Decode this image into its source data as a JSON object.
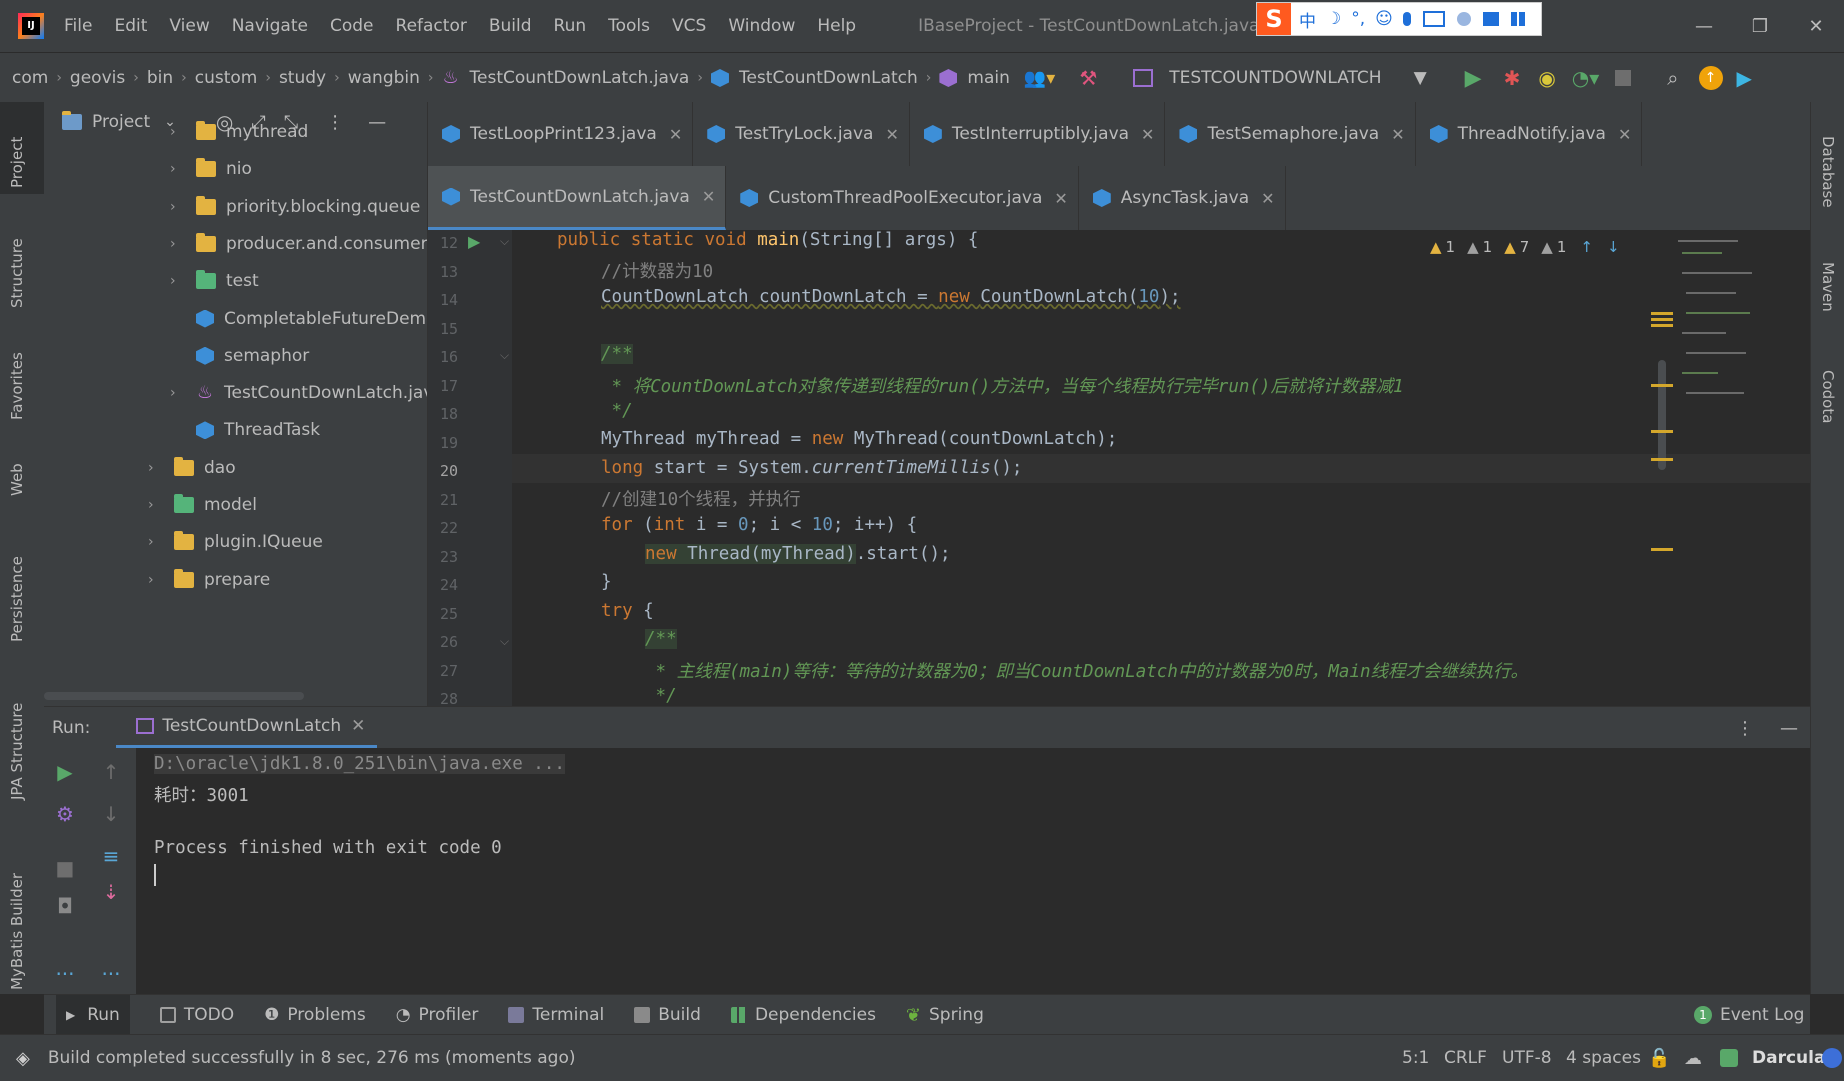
{
  "menu": {
    "items": [
      "File",
      "Edit",
      "View",
      "Navigate",
      "Code",
      "Refactor",
      "Build",
      "Run",
      "Tools",
      "VCS",
      "Window",
      "Help"
    ],
    "title": "IBaseProject - TestCountDownLatch.java",
    "ime": [
      "中",
      "☽",
      "°,",
      "☺",
      "🎤",
      "⌨"
    ]
  },
  "breadcrumb": {
    "items": [
      "com",
      "geovis",
      "bin",
      "custom",
      "study",
      "wangbin",
      "TestCountDownLatch.java",
      "TestCountDownLatch",
      "main"
    ],
    "run_config": "TESTCOUNTDOWNLATCH"
  },
  "left_tools": [
    "Project",
    "Structure",
    "Favorites",
    "Web",
    "Persistence",
    "JPA Structure",
    "MyBatis Builder"
  ],
  "right_tools": [
    "Database",
    "Maven",
    "Codota"
  ],
  "project_panel": {
    "title": "Project",
    "tree": [
      {
        "label": "mythread",
        "type": "folder",
        "indent": 1,
        "expandable": true
      },
      {
        "label": "nio",
        "type": "folder",
        "indent": 1,
        "expandable": true
      },
      {
        "label": "priority.blocking.queue",
        "type": "folder",
        "indent": 1,
        "expandable": true
      },
      {
        "label": "producer.and.consumer",
        "type": "folder",
        "indent": 1,
        "expandable": true
      },
      {
        "label": "test",
        "type": "folder-green",
        "indent": 1,
        "expandable": true
      },
      {
        "label": "CompletableFutureDemo",
        "type": "class",
        "indent": 1,
        "expandable": false
      },
      {
        "label": "semaphor",
        "type": "class",
        "indent": 1,
        "expandable": false
      },
      {
        "label": "TestCountDownLatch.java",
        "type": "java",
        "indent": 1,
        "expandable": true
      },
      {
        "label": "ThreadTask",
        "type": "class",
        "indent": 1,
        "expandable": false
      },
      {
        "label": "dao",
        "type": "folder",
        "indent": 0,
        "expandable": true
      },
      {
        "label": "model",
        "type": "folder-green",
        "indent": 0,
        "expandable": true
      },
      {
        "label": "plugin.IQueue",
        "type": "folder",
        "indent": 0,
        "expandable": true
      },
      {
        "label": "prepare",
        "type": "folder",
        "indent": 0,
        "expandable": true
      }
    ]
  },
  "tabs_row1": [
    "TestLoopPrint123.java",
    "TestTryLock.java",
    "TestInterruptibly.java",
    "TestSemaphore.java",
    "ThreadNotify.java"
  ],
  "tabs_row2": [
    "TestCountDownLatch.java",
    "CustomThreadPoolExecutor.java",
    "AsyncTask.java"
  ],
  "active_tab": "TestCountDownLatch.java",
  "inspections": {
    "a": "1",
    "b": "1",
    "c": "7",
    "d": "1"
  },
  "editor": {
    "line_numbers": [
      "12",
      "13",
      "14",
      "15",
      "16",
      "17",
      "18",
      "19",
      "20",
      "21",
      "22",
      "23",
      "24",
      "25",
      "26",
      "27",
      "28"
    ],
    "current_line": "20",
    "lines": {
      "l12": {
        "kw": "public static void ",
        "fn": "main",
        "rest": "(String[] args) {"
      },
      "l13": "//计数器为10",
      "l14": {
        "a": "CountDownLatch countDownLatch = ",
        "kw": "new ",
        "b": "CountDownLatch(",
        "num": "10",
        "c": ");"
      },
      "l16": "/**",
      "l17": " * 将CountDownLatch对象传递到线程的run()方法中，当每个线程执行完毕run()后就将计数器减1",
      "l18": " */",
      "l19": {
        "a": "MyThread myThread = ",
        "kw": "new ",
        "b": "MyThread(countDownLatch);"
      },
      "l20": {
        "kw": "long ",
        "a": "start = System.",
        "it": "currentTimeMillis",
        "b": "();"
      },
      "l21": "//创建10个线程，并执行",
      "l22": {
        "kw1": "for ",
        "a": "(",
        "kw2": "int ",
        "b": "i = ",
        "num1": "0",
        "c": "; i < ",
        "num2": "10",
        "d": "; i++) {"
      },
      "l23": {
        "kw": "new ",
        "a": "Thread(myThread)",
        ".b": "",
        "b": ".start();"
      },
      "l24": "}",
      "l25": {
        "kw": "try ",
        "a": "{"
      },
      "l26": "/**",
      "l27": " * 主线程(main)等待：等待的计数器为0；即当CountDownLatch中的计数器为0时，Main线程才会继续执行。",
      "l28": " */"
    }
  },
  "run": {
    "label": "Run:",
    "tab": "TestCountDownLatch",
    "output": [
      "D:\\oracle\\jdk1.8.0_251\\bin\\java.exe ...",
      "耗时：3001",
      "",
      "Process finished with exit code 0"
    ]
  },
  "tool_windows": [
    "Run",
    "TODO",
    "Problems",
    "Profiler",
    "Terminal",
    "Build",
    "Dependencies",
    "Spring"
  ],
  "event_log": {
    "count": "1",
    "label": "Event Log"
  },
  "status": {
    "message": "Build completed successfully in 8 sec, 276 ms (moments ago)",
    "position": "5:1",
    "line_sep": "CRLF",
    "encoding": "UTF-8",
    "indent": "4 spaces",
    "theme": "Darcula"
  }
}
